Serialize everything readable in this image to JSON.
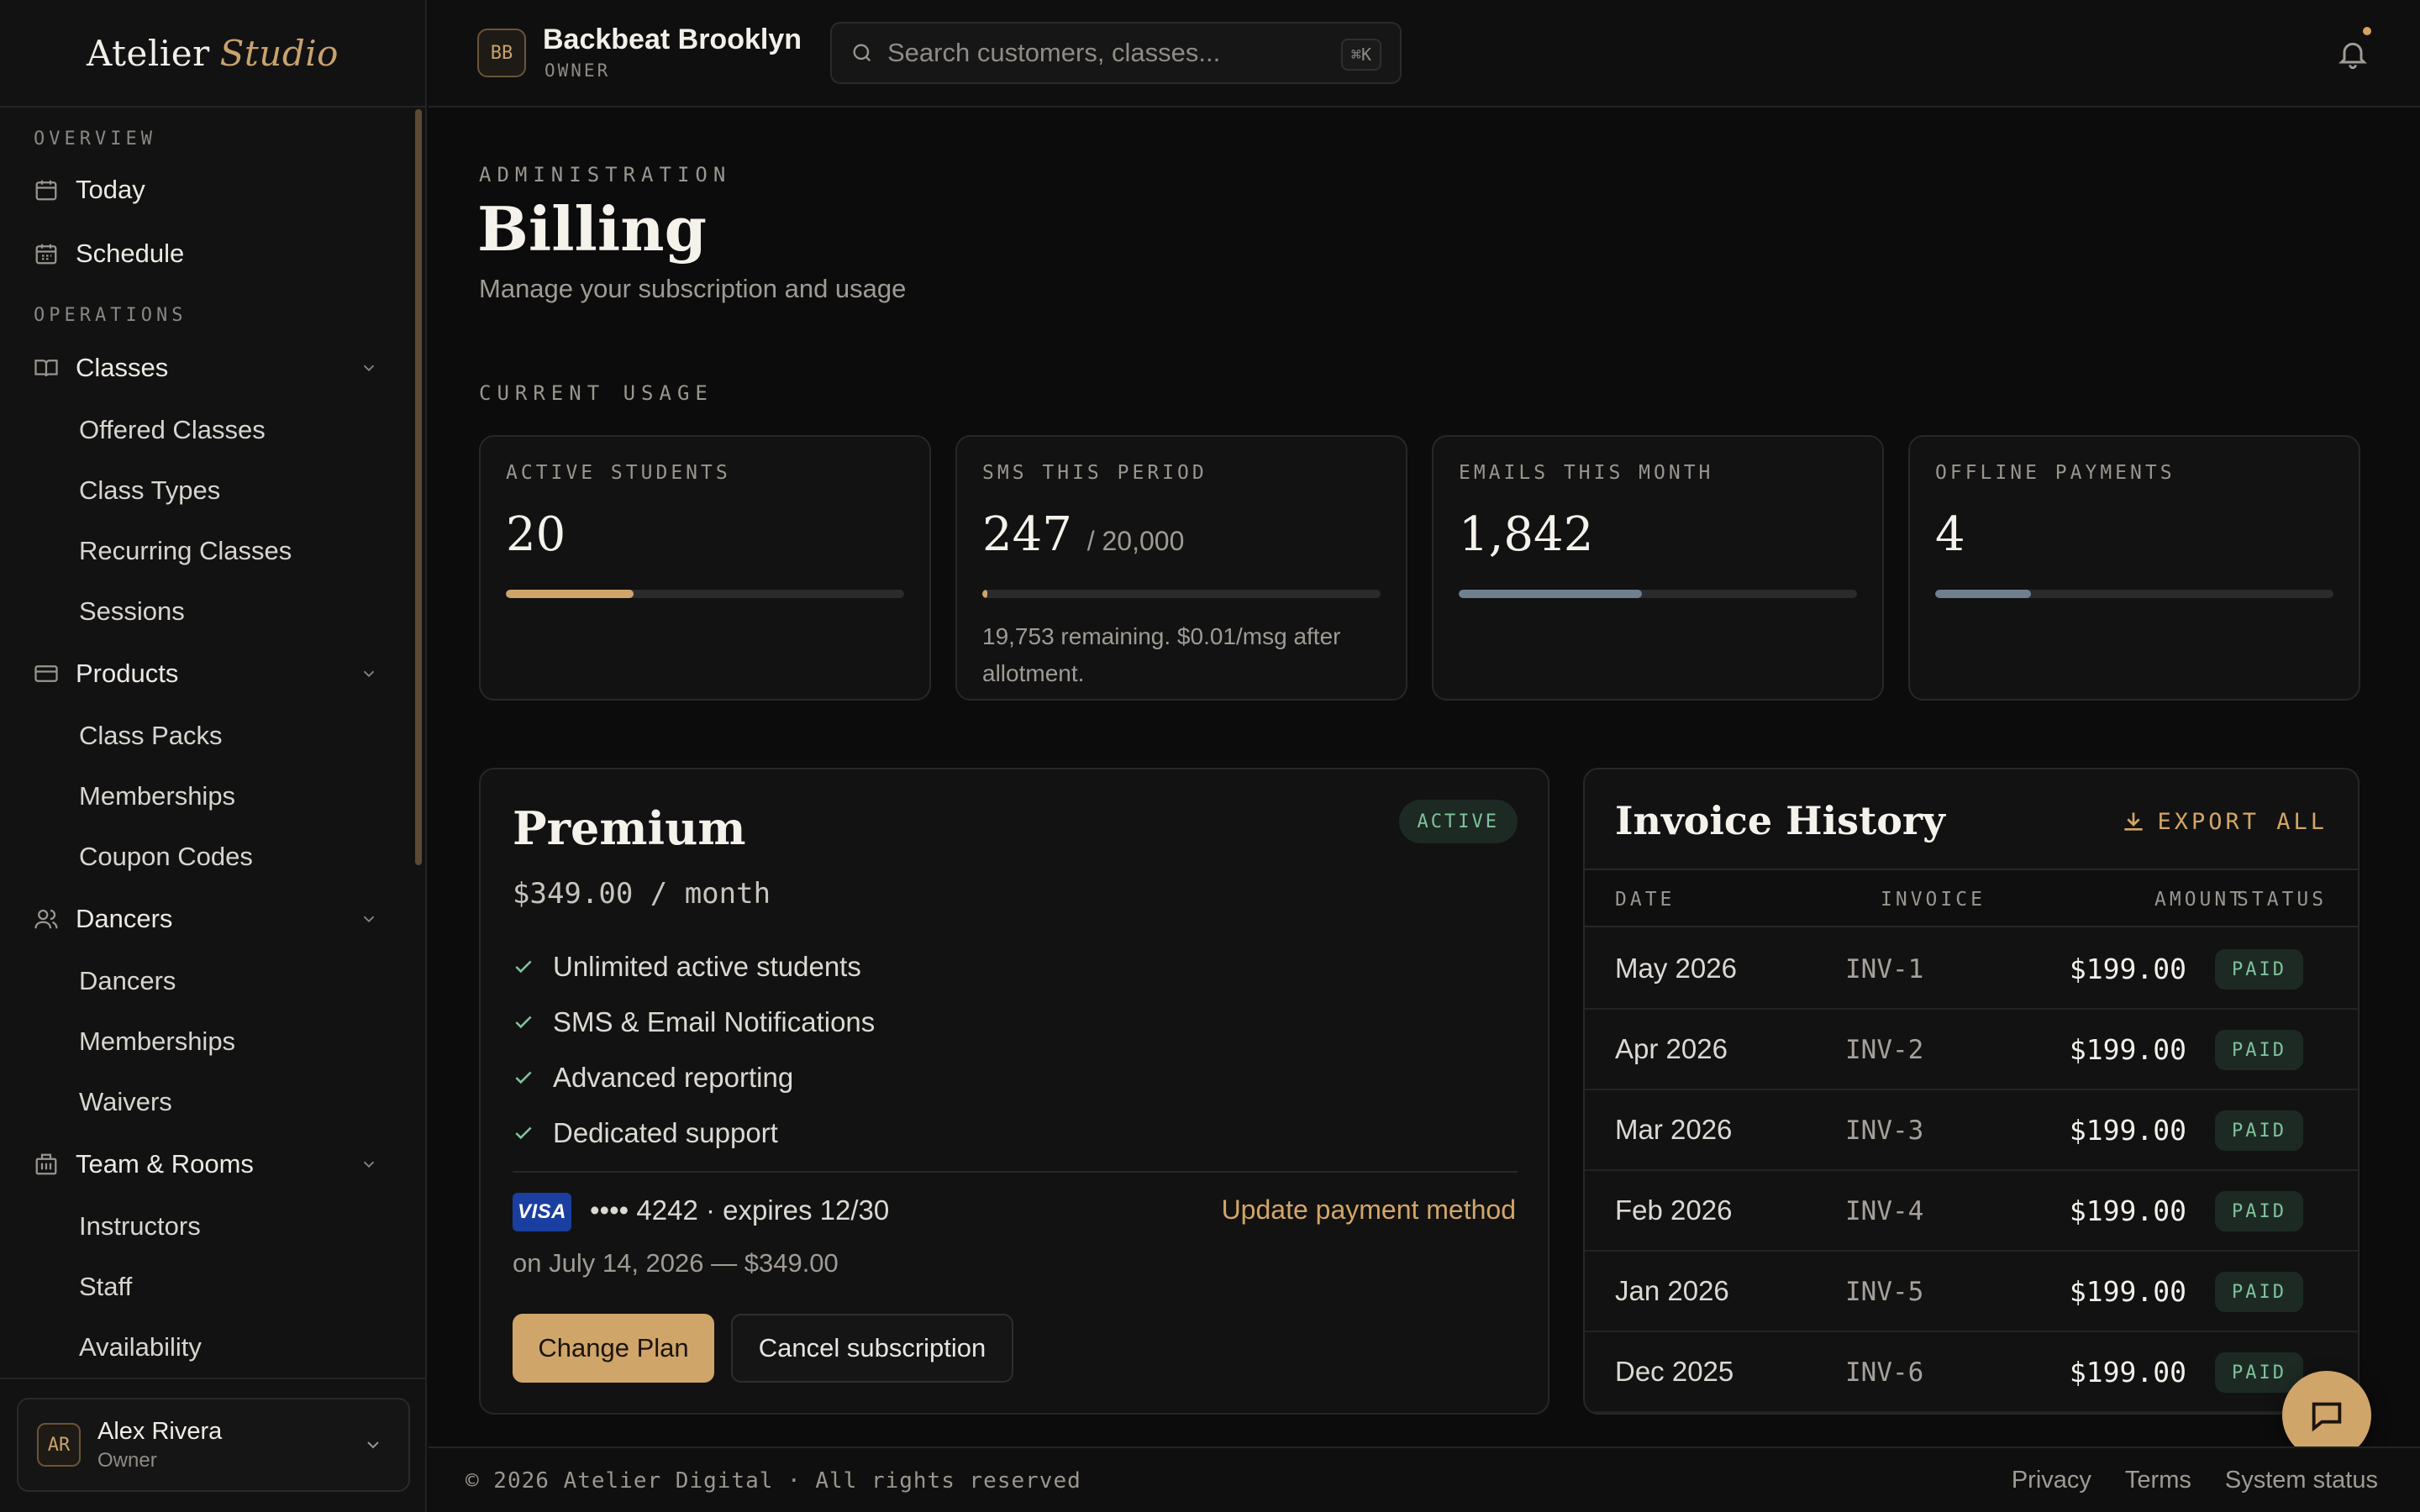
{
  "brand": {
    "name": "Atelier",
    "accent": "Studio"
  },
  "sidebar": {
    "sections": [
      {
        "label": "OVERVIEW"
      },
      {
        "label": "OPERATIONS"
      }
    ],
    "overview": [
      {
        "label": "Today",
        "icon": "calendar-icon"
      },
      {
        "label": "Schedule",
        "icon": "calendar-grid-icon"
      }
    ],
    "groups": [
      {
        "label": "Classes",
        "icon": "book-icon",
        "items": [
          "Offered Classes",
          "Class Types",
          "Recurring Classes",
          "Sessions"
        ]
      },
      {
        "label": "Products",
        "icon": "card-icon",
        "items": [
          "Class Packs",
          "Memberships",
          "Coupon Codes"
        ]
      },
      {
        "label": "Dancers",
        "icon": "users-icon",
        "items": [
          "Dancers",
          "Memberships",
          "Waivers"
        ]
      },
      {
        "label": "Team & Rooms",
        "icon": "building-icon",
        "items": [
          "Instructors",
          "Staff",
          "Availability"
        ]
      }
    ],
    "user": {
      "initials": "AR",
      "name": "Alex Rivera",
      "role": "Owner"
    }
  },
  "topbar": {
    "org_initials": "BB",
    "org_name": "Backbeat Brooklyn",
    "org_role": "OWNER",
    "search_placeholder": "Search customers, classes...",
    "search_shortcut": "⌘K"
  },
  "page": {
    "eyebrow": "ADMINISTRATION",
    "title": "Billing",
    "subtitle": "Manage your subscription and usage",
    "usage_heading": "CURRENT USAGE"
  },
  "usage": [
    {
      "label": "ACTIVE STUDENTS",
      "value": "20",
      "of": "",
      "fill": 0.32,
      "color": "#d0a56a",
      "note": ""
    },
    {
      "label": "SMS THIS PERIOD",
      "value": "247",
      "of": "/ 20,000",
      "fill": 0.012,
      "color": "#d0a56a",
      "note": "19,753 remaining. $0.01/msg after allotment."
    },
    {
      "label": "EMAILS THIS MONTH",
      "value": "1,842",
      "of": "",
      "fill": 0.46,
      "color": "#6f7f8f",
      "note": ""
    },
    {
      "label": "OFFLINE PAYMENTS",
      "value": "4",
      "of": "",
      "fill": 0.24,
      "color": "#6f7f8f",
      "note": ""
    }
  ],
  "plan": {
    "name": "Premium",
    "status": "ACTIVE",
    "price": "$349.00 / month",
    "features": [
      "Unlimited active students",
      "SMS & Email Notifications",
      "Advanced reporting",
      "Dedicated support"
    ],
    "card_brand": "VISA",
    "card_info": "•••• 4242 · expires 12/30",
    "update_label": "Update payment method",
    "renewal": "on July 14, 2026 — $349.00",
    "change_label": "Change Plan",
    "cancel_label": "Cancel subscription"
  },
  "invoices": {
    "title": "Invoice History",
    "export_label": "EXPORT ALL",
    "columns": [
      "DATE",
      "INVOICE",
      "AMOUNT",
      "STATUS"
    ],
    "rows": [
      {
        "date": "May 2026",
        "invoice": "INV-1",
        "amount": "$199.00",
        "status": "PAID"
      },
      {
        "date": "Apr 2026",
        "invoice": "INV-2",
        "amount": "$199.00",
        "status": "PAID"
      },
      {
        "date": "Mar 2026",
        "invoice": "INV-3",
        "amount": "$199.00",
        "status": "PAID"
      },
      {
        "date": "Feb 2026",
        "invoice": "INV-4",
        "amount": "$199.00",
        "status": "PAID"
      },
      {
        "date": "Jan 2026",
        "invoice": "INV-5",
        "amount": "$199.00",
        "status": "PAID"
      },
      {
        "date": "Dec 2025",
        "invoice": "INV-6",
        "amount": "$199.00",
        "status": "PAID"
      }
    ]
  },
  "footer": {
    "copyright": "© 2026 Atelier Digital · All rights reserved",
    "links": [
      "Privacy",
      "Terms",
      "System status"
    ]
  },
  "colors": {
    "accent": "#d0a56a",
    "success": "#7fc39a",
    "background": "#0c0c0d"
  }
}
